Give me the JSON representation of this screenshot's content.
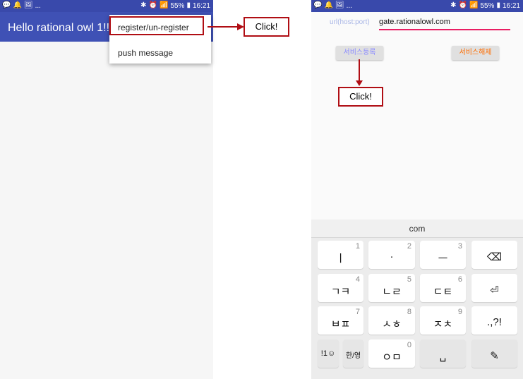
{
  "left_screen": {
    "status_left": "...",
    "status_right": {
      "battery": "55%",
      "time": "16:21"
    },
    "app_title": "Hello rational owl 1!!",
    "menu": [
      {
        "label": "register/un-register"
      },
      {
        "label": "push message"
      }
    ],
    "callout": "Click!"
  },
  "right_screen": {
    "status_left": "...",
    "status_right": {
      "battery": "55%",
      "time": "16:21"
    },
    "url_label": "url(host:port)",
    "url_value": "gate.rationalowl.com",
    "register_button": "서비스등록",
    "unregister_button": "서비스해제",
    "callout": "Click!",
    "keyboard": {
      "suggestion": "com",
      "rows": [
        [
          {
            "main": "ㅣ",
            "num": "1"
          },
          {
            "main": "·",
            "num": "2"
          },
          {
            "main": "ㅡ",
            "num": "3"
          },
          {
            "main": "⌫",
            "num": ""
          }
        ],
        [
          {
            "main": "ㄱㅋ",
            "num": "4"
          },
          {
            "main": "ㄴㄹ",
            "num": "5"
          },
          {
            "main": "ㄷㅌ",
            "num": "6"
          },
          {
            "main": "⏎",
            "num": ""
          }
        ],
        [
          {
            "main": "ㅂㅍ",
            "num": "7"
          },
          {
            "main": "ㅅㅎ",
            "num": "8"
          },
          {
            "main": "ㅈㅊ",
            "num": "9"
          },
          {
            "main": ".,?!",
            "num": ""
          }
        ],
        [
          {
            "main": "!1☺",
            "num": ""
          },
          {
            "main": "한/영",
            "num": ""
          },
          {
            "main": "ㅇㅁ",
            "num": "0"
          },
          {
            "main": "␣",
            "num": ""
          },
          {
            "main": "✎",
            "num": ""
          }
        ]
      ]
    }
  },
  "colors": {
    "status": "#3949ab",
    "appbar": "#3f51b5",
    "highlight": "#b00e14",
    "url_underline": "#e91e63",
    "unregister_text": "#ff6d00",
    "register_text": "#8c8cff"
  }
}
